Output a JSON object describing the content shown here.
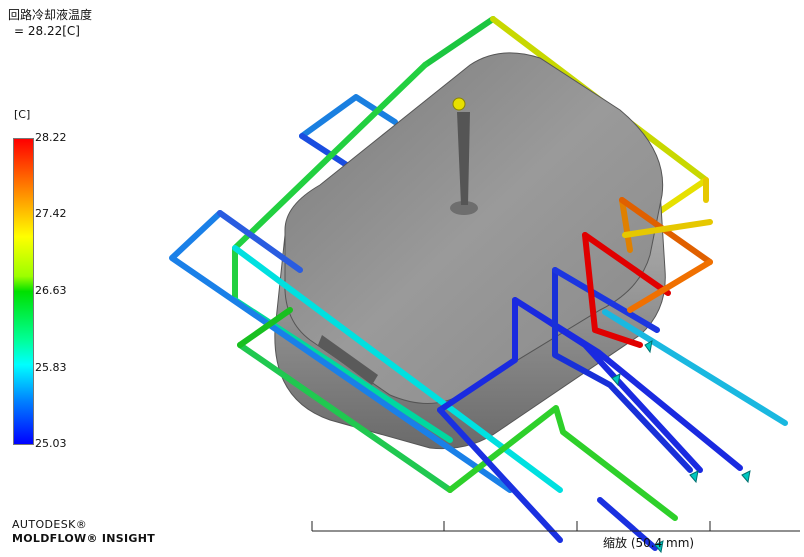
{
  "result": {
    "title": "回路冷却液温度",
    "value": " = 28.22[C]"
  },
  "legend": {
    "unit": "[C]",
    "ticks": [
      "28.22",
      "27.42",
      "26.63",
      "25.83",
      "25.03"
    ],
    "colors": {
      "max": "#ff0000",
      "high": "#ffff00",
      "mid": "#00e000",
      "low_mid": "#00ffff",
      "min": "#0000ff"
    }
  },
  "branding": {
    "line1": "AUTODESK®",
    "line2": "MOLDFLOW® INSIGHT"
  },
  "scale_bar": {
    "label": "缩放 (50.4 mm)"
  },
  "scene": {
    "part_color": "#8c8c8c",
    "injection_point_color": "#e8e000"
  }
}
